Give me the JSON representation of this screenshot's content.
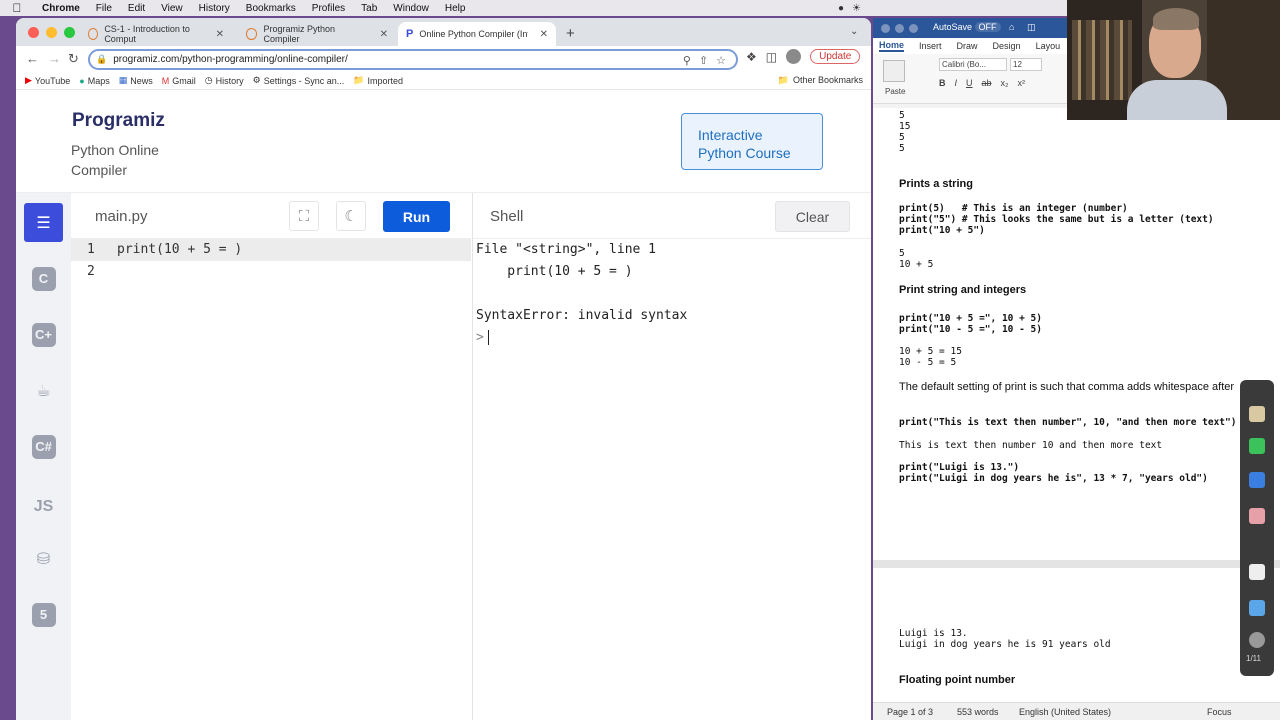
{
  "menubar": {
    "app": "Chrome",
    "items": [
      "File",
      "Edit",
      "View",
      "History",
      "Bookmarks",
      "Profiles",
      "Tab",
      "Window",
      "Help"
    ]
  },
  "browser": {
    "tabs": [
      {
        "title": "CS-1 - Introduction to Comput"
      },
      {
        "title": "Programiz Python Compiler"
      },
      {
        "title": "Online Python Compiler (Interp"
      }
    ],
    "url": "programiz.com/python-programming/online-compiler/",
    "update_label": "Update",
    "bookmarks": [
      "YouTube",
      "Maps",
      "News",
      "Gmail",
      "History",
      "Settings - Sync an...",
      "Imported"
    ],
    "other_bookmarks": "Other Bookmarks"
  },
  "programiz": {
    "logo": "Programiz",
    "subtitle": "Python Online Compiler",
    "course_button": "Interactive Python Course",
    "filename": "main.py",
    "run_label": "Run",
    "shell_title": "Shell",
    "clear_label": "Clear",
    "code_lines": [
      {
        "num": "1",
        "text": "print(10 + 5 = )"
      },
      {
        "num": "2",
        "text": ""
      }
    ],
    "shell_output": [
      "File \"<string>\", line 1",
      "    print(10 + 5 = )",
      "",
      "SyntaxError: invalid syntax"
    ],
    "prompt": ">",
    "lang_icons": [
      "python-icon",
      "c-icon",
      "cplusplus-icon",
      "java-icon",
      "csharp-icon",
      "js-icon",
      "sql-icon",
      "html-icon"
    ],
    "lang_js_label": "JS"
  },
  "word": {
    "autosave": "AutoSave",
    "autosave_state": "OFF",
    "ribbon_tabs": [
      "Home",
      "Insert",
      "Draw",
      "Design",
      "Layou"
    ],
    "font": "Calibri (Bo...",
    "size": "12",
    "paste_label": "Paste",
    "doc": {
      "top_numbers": [
        "5",
        "15",
        "5",
        "5"
      ],
      "h1": "Prints a string",
      "code1": [
        "print(5)   # This is an integer (number)",
        "print(\"5\") # This looks the same but is a letter (text)",
        "print(\"10 + 5\")"
      ],
      "out1": [
        "5",
        "10 + 5"
      ],
      "h2": "Print string and integers",
      "code2": [
        "print(\"10 + 5 =\", 10 + 5)",
        "print(\"10 - 5 =\", 10 - 5)"
      ],
      "out2": [
        "10 + 5 = 15",
        "10 - 5 = 5"
      ],
      "para": "The default setting of print is such that comma adds whitespace after",
      "code3": "print(\"This is text then number\", 10, \"and then more text\")",
      "out3": "This is text then number 10 and then more text",
      "code4": [
        "print(\"Luigi is 13.\")",
        "print(\"Luigi in dog years he is\", 13 * 7, \"years old\")"
      ],
      "out4": [
        "Luigi is 13.",
        "Luigi in dog years he is 91 years old"
      ],
      "h3": "Floating point number"
    },
    "status": {
      "page": "Page 1 of 3",
      "words": "553 words",
      "language": "English (United States)",
      "focus": "Focus"
    },
    "ink_page": "1/11"
  },
  "colors": {
    "programiz_blue": "#0d5cdb",
    "word_blue": "#2b579a"
  }
}
